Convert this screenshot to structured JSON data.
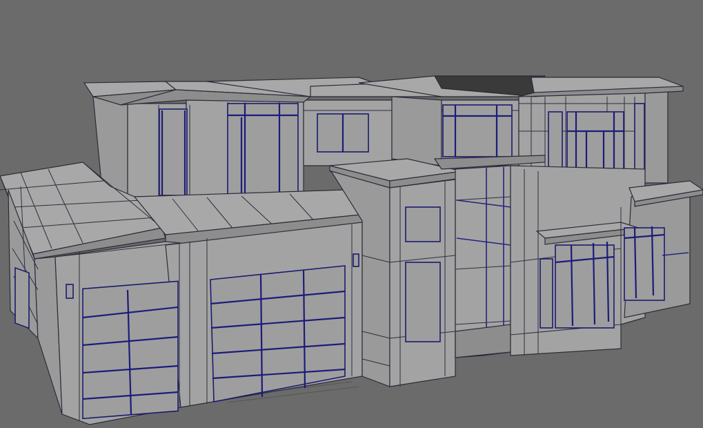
{
  "viewport": {
    "background": "#6b6b6b",
    "model_fill": "#a3a3a3",
    "wire_color": "#1b1b7a",
    "edge_color": "#2b2b3a"
  }
}
